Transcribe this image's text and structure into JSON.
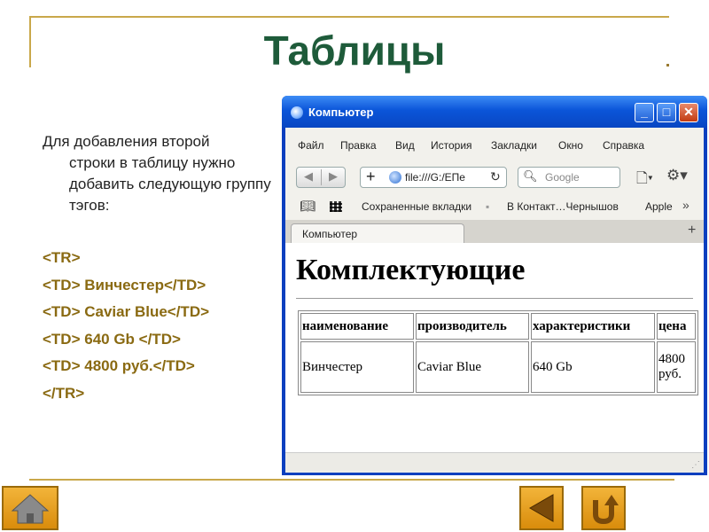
{
  "slide": {
    "title": "Таблицы",
    "intro_first": "Для добавления второй",
    "intro_rest": "строки в таблицу нужно добавить следующую группу тэгов:",
    "code_lines": [
      "<TR>",
      "<TD> Винчестер</TD>",
      "<TD> Caviar Blue</TD>",
      "<TD> 640 Gb </TD>",
      "<TD> 4800 руб.</TD>",
      "</TR>"
    ]
  },
  "browser": {
    "window_title": "Компьютер",
    "menu": [
      "Файл",
      "Правка",
      "Вид",
      "История",
      "Закладки",
      "Окно",
      "Справка"
    ],
    "url": "file:///G:/EПe",
    "search_placeholder": "Google",
    "bookmarks": [
      "Сохраненные вкладки",
      "В Контакт…Чернышов",
      "Apple"
    ],
    "tab_label": "Компьютер",
    "page": {
      "heading": "Комплектующие",
      "table_headers": [
        "наименование",
        "производитель",
        "характеристики",
        "цена"
      ],
      "table_row": [
        "Винчестер",
        "Caviar Blue",
        "640 Gb",
        "4800 руб."
      ]
    }
  },
  "colors": {
    "title": "#1e5b3a",
    "code": "#8a6a12",
    "frame_lines": "#c9a84a",
    "nav_buttons": "#e8a020",
    "window_frame": "#0b3fbf"
  },
  "icons": {
    "home": "home-icon",
    "back": "back-triangle-icon",
    "return": "return-arrow-icon"
  }
}
